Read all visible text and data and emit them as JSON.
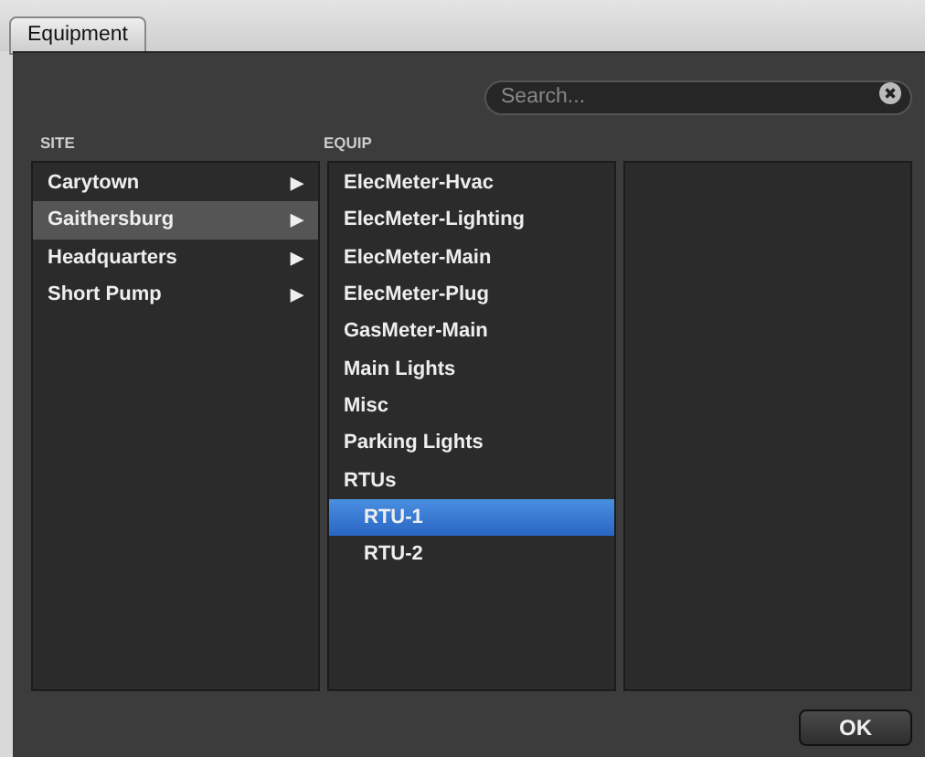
{
  "tab": {
    "label": "Equipment"
  },
  "search": {
    "placeholder": "Search..."
  },
  "site": {
    "heading": "SITE",
    "items": [
      {
        "label": "Carytown",
        "selected": false,
        "arrow": "▶"
      },
      {
        "label": "Gaithersburg",
        "selected": true,
        "arrow": "▶"
      },
      {
        "label": "Headquarters",
        "selected": false,
        "arrow": "▶"
      },
      {
        "label": "Short Pump",
        "selected": false,
        "arrow": "▶"
      }
    ]
  },
  "equip": {
    "heading": "EQUIP",
    "items": [
      {
        "label": "ElecMeter-Hvac",
        "selected": false
      },
      {
        "label": "ElecMeter-Lighting",
        "selected": false
      },
      {
        "label": "ElecMeter-Main",
        "selected": false
      },
      {
        "label": "ElecMeter-Plug",
        "selected": false
      },
      {
        "label": "GasMeter-Main",
        "selected": false
      },
      {
        "label": "Main Lights",
        "selected": false
      },
      {
        "label": "Misc",
        "selected": false
      },
      {
        "label": "Parking Lights",
        "selected": false
      },
      {
        "label": "RTUs",
        "selected": false,
        "children": [
          {
            "label": "RTU-1",
            "selected": true
          },
          {
            "label": "RTU-2",
            "selected": false
          }
        ]
      }
    ]
  },
  "ok_button": "OK"
}
